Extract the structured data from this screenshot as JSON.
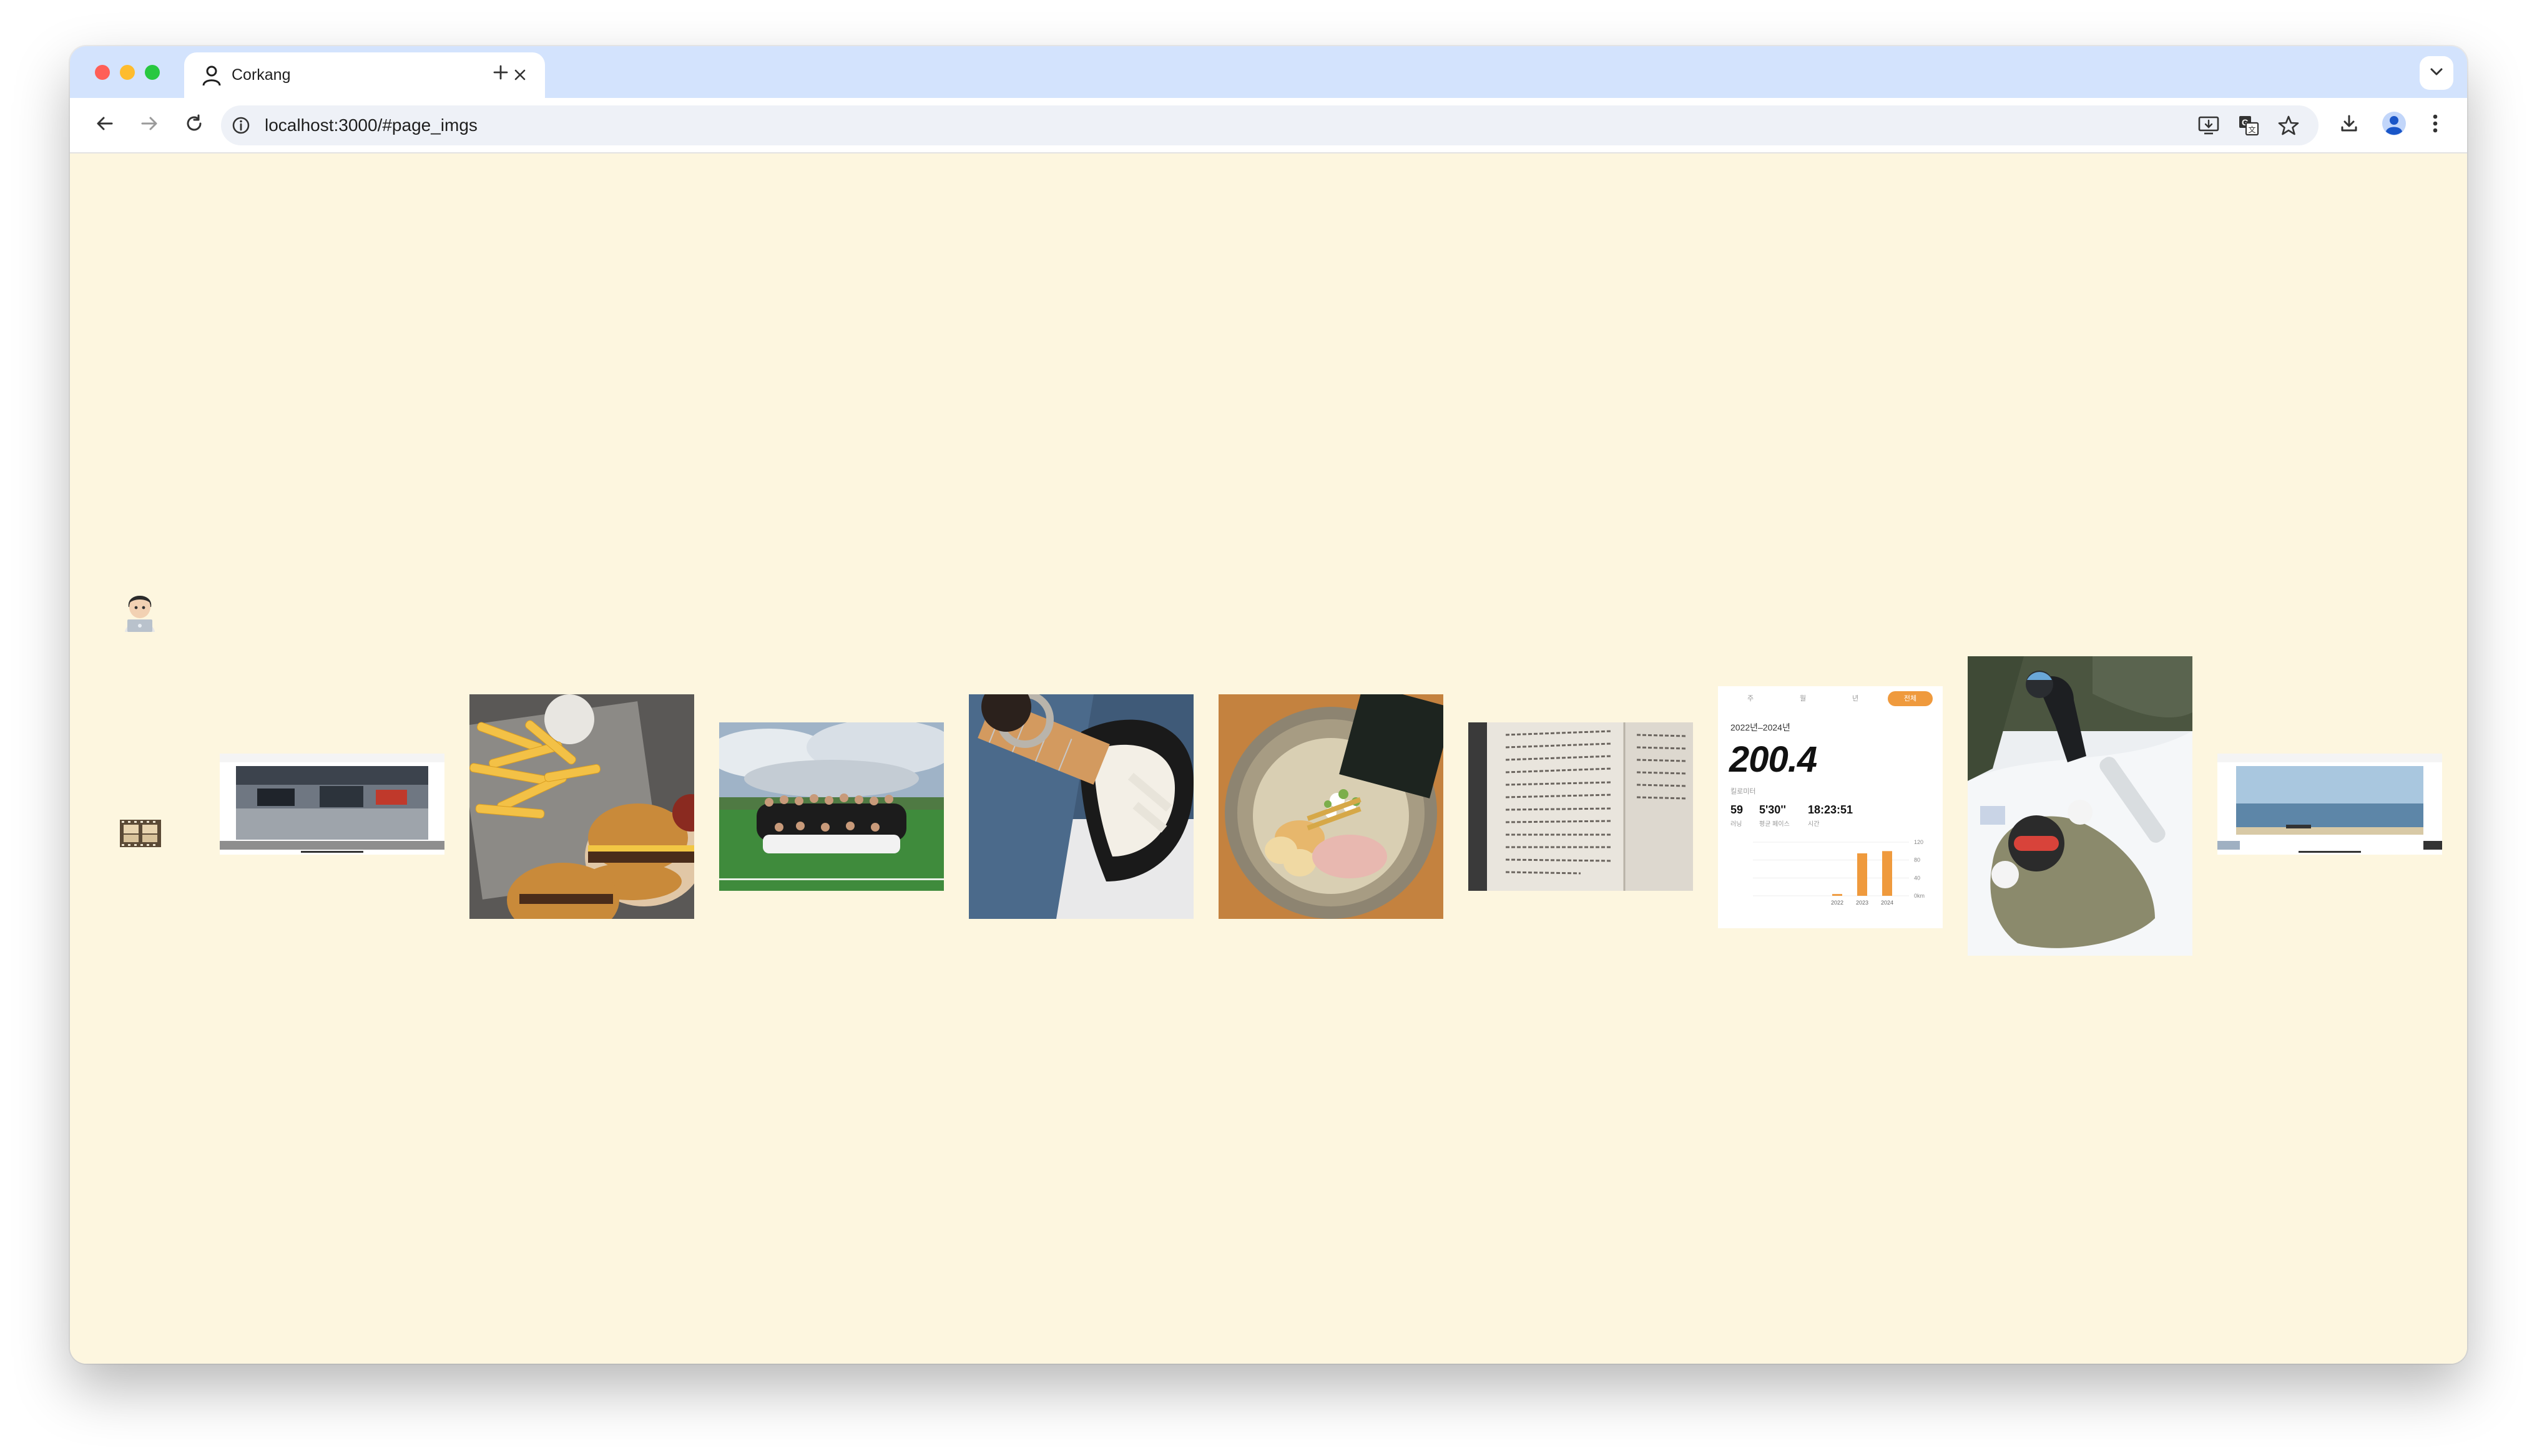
{
  "browser": {
    "tab": {
      "title": "Corkang",
      "favicon": "person-icon"
    },
    "new_tab_icon": "plus-icon",
    "address": {
      "url": "localhost:3000/#page_imgs",
      "site_info_icon": "info-icon"
    },
    "toolbar_icons": [
      "back-icon",
      "forward-icon",
      "reload-icon",
      "install-app-icon",
      "translate-icon",
      "bookmark-star-icon",
      "download-icon",
      "profile-icon",
      "menu-icon"
    ]
  },
  "page": {
    "background": "#fdf6df",
    "side_icons": [
      "technologist-emoji",
      "film-frames-emoji"
    ],
    "gallery": [
      {
        "name": "screenshot-gym-page"
      },
      {
        "name": "burger-fries-photo"
      },
      {
        "name": "soccer-team-photo"
      },
      {
        "name": "guitar-photo"
      },
      {
        "name": "ramen-bowl-photo"
      },
      {
        "name": "book-page-photo"
      },
      {
        "name": "running-stats-screenshot"
      },
      {
        "name": "snowboard-photo"
      },
      {
        "name": "screenshot-beach-page"
      }
    ],
    "stats_card": {
      "tabs": [
        "주",
        "월",
        "년",
        "전체"
      ],
      "range": "2022년–2024년",
      "distance": "200.4",
      "distance_unit": "킬로미터",
      "runs": "59",
      "runs_label": "러닝",
      "pace": "5'30''",
      "pace_label": "평균 페이스",
      "time": "18:23:51",
      "time_label": "시간"
    }
  },
  "chart_data": {
    "type": "bar",
    "categories": [
      "2022",
      "2023",
      "2024"
    ],
    "values": [
      4,
      95,
      100
    ],
    "ylim": [
      0,
      120
    ],
    "yticks": [
      "0km",
      "40",
      "80",
      "120"
    ],
    "color": "#ef9a3d"
  }
}
